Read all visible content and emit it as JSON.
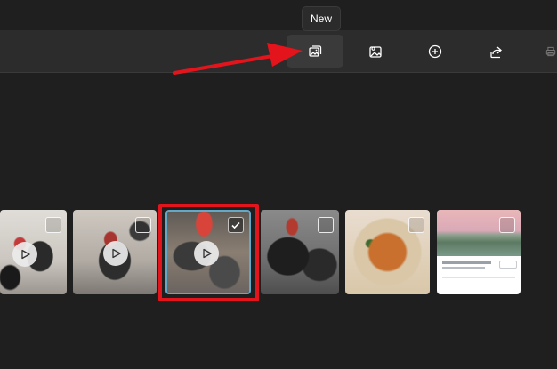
{
  "tooltip": {
    "text": "New"
  },
  "toolbar": {
    "buttons": [
      {
        "name": "new-button",
        "icon": "new-photos-icon",
        "active": true
      },
      {
        "name": "import-button",
        "icon": "import-image-icon",
        "active": false
      },
      {
        "name": "add-button",
        "icon": "add-circle-icon",
        "active": false
      },
      {
        "name": "share-button",
        "icon": "share-icon",
        "active": false
      },
      {
        "name": "print-button",
        "icon": "print-icon",
        "active": false
      }
    ]
  },
  "gallery": {
    "items": [
      {
        "kind": "video",
        "selected": false,
        "colors": [
          "#d8d4cf",
          "#2a2a2a",
          "#c43a3a"
        ]
      },
      {
        "kind": "video",
        "selected": false,
        "colors": [
          "#b7b2ab",
          "#2d2d2d",
          "#a8342f"
        ]
      },
      {
        "kind": "video",
        "selected": true,
        "colors": [
          "#8a7e72",
          "#3a3a3a",
          "#d9443a"
        ]
      },
      {
        "kind": "photo",
        "selected": false,
        "colors": [
          "#6e6e6e",
          "#1e1e1e",
          "#b23a2f"
        ]
      },
      {
        "kind": "photo",
        "selected": false,
        "colors": [
          "#d9c7a8",
          "#c9702e",
          "#e9ddd0"
        ]
      },
      {
        "kind": "screenshot",
        "selected": false,
        "colors": [
          "#e9b7b8",
          "#5c7a62",
          "#ffffff"
        ]
      }
    ]
  },
  "colors": {
    "accent_red": "#e3141b",
    "selection_blue": "#64a8c8"
  }
}
